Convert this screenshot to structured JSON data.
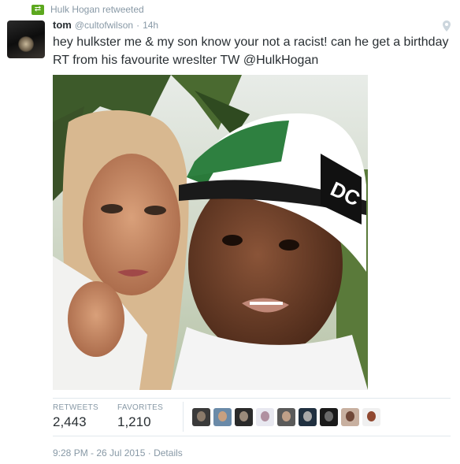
{
  "retweet_context": {
    "label": "Hulk Hogan retweeted",
    "icon": "retweet-icon"
  },
  "tweet": {
    "name": "tom",
    "handle": "@cultofwilson",
    "separator": "·",
    "time": "14h",
    "text": "hey hulkster me & my son know your not a racist! can he get a birthday RT from his favourite wreslter TW @HulkHogan"
  },
  "stats": {
    "retweets_label": "RETWEETS",
    "retweets_count": "2,443",
    "favorites_label": "FAVORITES",
    "favorites_count": "1,210"
  },
  "favoriters": [
    {
      "bg": "#3a3a3a",
      "face": "#8a7a6a"
    },
    {
      "bg": "#6a8aa8",
      "face": "#c8a080"
    },
    {
      "bg": "#2a2a2a",
      "face": "#9a8a7a"
    },
    {
      "bg": "#e8e8f0",
      "face": "#b090a0"
    },
    {
      "bg": "#5a5a5a",
      "face": "#c0a088"
    },
    {
      "bg": "#203040",
      "face": "#a8a8a8"
    },
    {
      "bg": "#1a1a1a",
      "face": "#6a6a6a"
    },
    {
      "bg": "#c8b0a0",
      "face": "#704838"
    },
    {
      "bg": "#f0f0f0",
      "face": "#904830"
    }
  ],
  "footer": {
    "timestamp": "9:28 PM - 26 Jul 2015",
    "separator": "·",
    "details": "Details"
  },
  "colors": {
    "muted": "#8899a6",
    "text": "#292f33",
    "retweet_green": "#5ca81e",
    "divider": "#e1e8ed"
  }
}
